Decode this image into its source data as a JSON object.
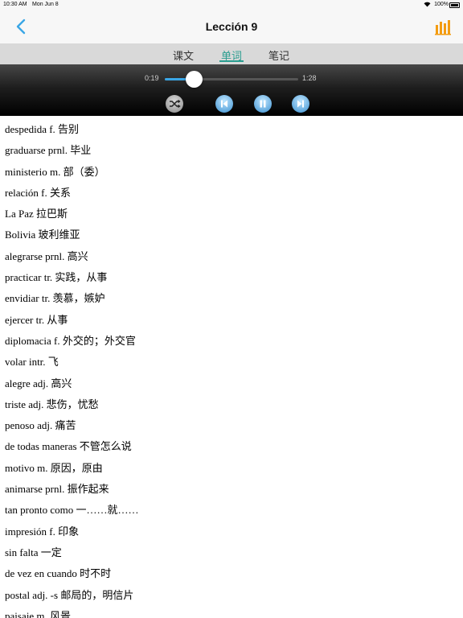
{
  "status_bar": {
    "time": "10:30 AM",
    "date": "Mon Jun 8",
    "battery": "100%"
  },
  "nav": {
    "title": "Lección 9",
    "back_icon": "chevron-left-icon",
    "right_icon": "bar-chart-icon",
    "accent_color": "#3aa6e6",
    "chart_color": "#f39c12"
  },
  "tabs": [
    {
      "label": "课文",
      "active": false
    },
    {
      "label": "单词",
      "active": true
    },
    {
      "label": "笔记",
      "active": false
    }
  ],
  "player": {
    "elapsed": "0:19",
    "total": "1:28",
    "progress": 0.216,
    "controls": [
      "shuffle-icon",
      "previous-icon",
      "pause-icon",
      "next-icon"
    ]
  },
  "vocabulary": [
    "despedida f. 告别",
    "graduarse prnl. 毕业",
    "ministerio m. 部（委）",
    "relación f. 关系",
    "La Paz  拉巴斯",
    "Bolivia  玻利维亚",
    "alegrarse prnl. 高兴",
    "practicar tr. 实践，从事",
    "envidiar tr. 羡慕，嫉妒",
    "ejercer tr. 从事",
    "diplomacia f. 外交的；外交官",
    "volar intr. 飞",
    "alegre adj. 高兴",
    "triste adj. 悲伤，忧愁",
    "penoso adj. 痛苦",
    "de todas maneras  不管怎么说",
    "motivo m. 原因，原由",
    "animarse prnl. 振作起来",
    "tan pronto como  一……就……",
    "impresión f. 印象",
    "sin falta  一定",
    "de vez en cuando  时不时",
    "postal adj. -s 邮局的，明信片",
    "paisaje m. 风景"
  ]
}
